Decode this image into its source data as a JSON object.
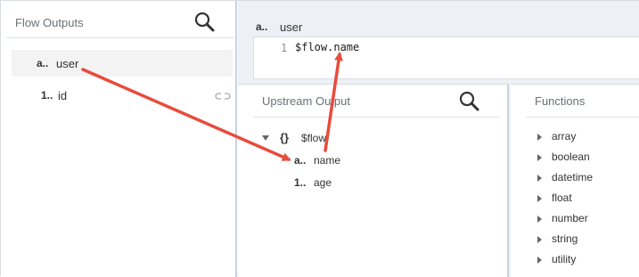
{
  "flow_outputs": {
    "title": "Flow Outputs",
    "items": [
      {
        "type": "a..",
        "label": "user"
      },
      {
        "type": "1..",
        "label": "id"
      }
    ]
  },
  "editor": {
    "field_type": "a..",
    "field_name": "user",
    "line_number": "1",
    "code": "$flow.name"
  },
  "upstream_output": {
    "title": "Upstream Output",
    "root": {
      "icon": "{}",
      "label": "$flow"
    },
    "children": [
      {
        "type": "a..",
        "label": "name"
      },
      {
        "type": "1..",
        "label": "age"
      }
    ]
  },
  "functions": {
    "title": "Functions",
    "items": [
      "array",
      "boolean",
      "datetime",
      "float",
      "number",
      "string",
      "utility"
    ]
  },
  "colors": {
    "arrow": "#e74c3c",
    "panel_border": "#c9d3e2",
    "editor_bg": "#edf0f5"
  }
}
